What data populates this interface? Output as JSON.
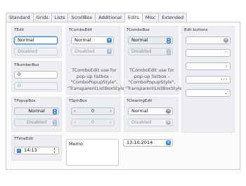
{
  "tabs": [
    "Standard",
    "Grids",
    "Lists",
    "ScrollBox",
    "Additional",
    "Edits",
    "Misc",
    "Extended"
  ],
  "active_tab": "Edits",
  "tedit": {
    "title": "TEdit",
    "value": "Normal",
    "disabled": "Disabled"
  },
  "tcomboedit": {
    "title": "TComboEdit",
    "value": "Normal",
    "disabled": "Disabled",
    "note": "TComboEdit use for pop-up listbox - \"ComboPopupStyle\", \"TransparentListBoxStyle\""
  },
  "tcombobox": {
    "title": "TComboBox",
    "value": "Normal",
    "disabled": "Disabled",
    "note": "TComboEdit use for pop-up listbox - \"ComboPopupStyle\", \"TransparentListBoxStyle\""
  },
  "editbuttons": {
    "title": "Edit buttons"
  },
  "tnumberbox": {
    "title": "TNumberBox",
    "value": "0",
    "disabled": "0"
  },
  "tpopupbox": {
    "title": "TPopupBox",
    "value": "Normal",
    "disabled": "Disabled"
  },
  "tspinbox": {
    "title": "TSpinBox",
    "value": "0",
    "disabled": "0"
  },
  "tclearingedit": {
    "title": "TClearingEdit",
    "value": "Normal",
    "disabled": "Disabled"
  },
  "ttimeedit": {
    "title": "TTimeEdit",
    "value": "14:13"
  },
  "memo": {
    "text": "Memo"
  },
  "dateedit": {
    "value": "13.10.2014"
  },
  "icons": {
    "combo": "chevron-down-icon",
    "clear": "clear-icon",
    "search": "search-icon",
    "ellipsis": "ellipsis-icon",
    "password": "eye-icon",
    "spin_left": "chevron-left-icon",
    "spin_right": "chevron-right-icon"
  },
  "colors": {
    "accent": "#4b8fdc",
    "group_bg": "#eceef1",
    "focus_border": "#3b8de0"
  }
}
